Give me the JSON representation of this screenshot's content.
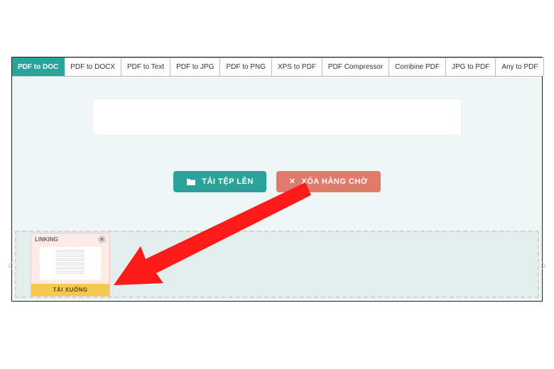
{
  "tabs": [
    {
      "label": "PDF to DOC",
      "active": true
    },
    {
      "label": "PDF to DOCX",
      "active": false
    },
    {
      "label": "PDF to Text",
      "active": false
    },
    {
      "label": "PDF to JPG",
      "active": false
    },
    {
      "label": "PDF to PNG",
      "active": false
    },
    {
      "label": "XPS to PDF",
      "active": false
    },
    {
      "label": "PDF Compressor",
      "active": false
    },
    {
      "label": "Combine PDF",
      "active": false
    },
    {
      "label": "JPG to PDF",
      "active": false
    },
    {
      "label": "Any to PDF",
      "active": false
    }
  ],
  "buttons": {
    "upload": "TẢI TỆP LÊN",
    "clear": "XÓA HÀNG CHỜ"
  },
  "card": {
    "title": "LINKING",
    "download": "TẢI XUỐNG"
  }
}
